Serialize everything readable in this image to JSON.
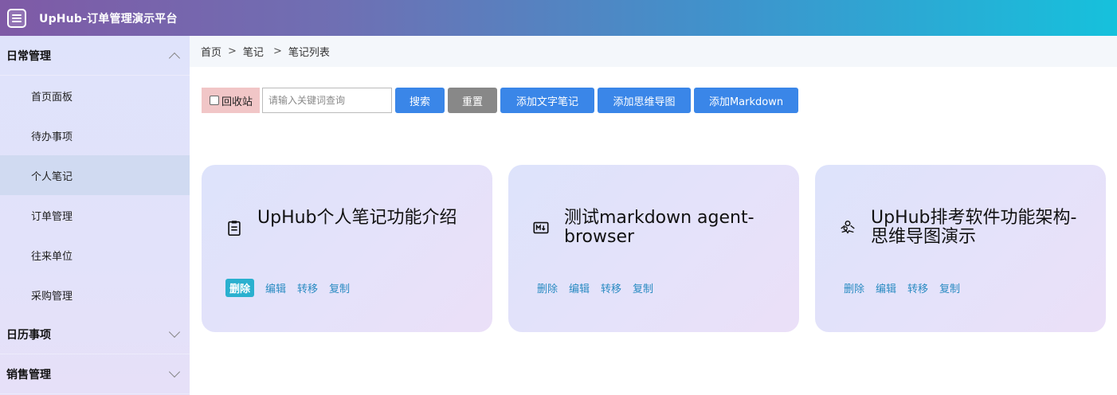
{
  "header": {
    "title": "UpHub-订单管理演示平台",
    "logo_icon": "list-doc-icon"
  },
  "sidebar": {
    "groups": [
      {
        "label": "日常管理",
        "expanded": true,
        "items": [
          {
            "label": "首页面板"
          },
          {
            "label": "待办事项"
          },
          {
            "label": "个人笔记",
            "active": true
          },
          {
            "label": "订单管理"
          },
          {
            "label": "往来单位"
          },
          {
            "label": "采购管理"
          }
        ]
      },
      {
        "label": "日历事项",
        "expanded": false
      },
      {
        "label": "销售管理",
        "expanded": false
      }
    ]
  },
  "breadcrumb": {
    "items": [
      "首页",
      "笔记",
      "笔记列表"
    ],
    "separator": ">"
  },
  "toolbar": {
    "recycle_label": "回收站",
    "recycle_checked": false,
    "search_placeholder": "请输入关键词查询",
    "search_value": "",
    "buttons": [
      "搜索",
      "重置",
      "添加文字笔记",
      "添加思维导图",
      "添加Markdown"
    ]
  },
  "notes": [
    {
      "title": "UpHub个人笔记功能介绍",
      "icon": "clipboard-note-icon",
      "actions": [
        "删除",
        "编辑",
        "转移",
        "复制"
      ]
    },
    {
      "title": "测试markdown agent-browser",
      "icon": "markdown-icon",
      "actions": [
        "删除",
        "编辑",
        "转移",
        "复制"
      ]
    },
    {
      "title": "UpHub排考软件功能架构-思维导图演示",
      "icon": "mindmap-icon",
      "actions": [
        "删除",
        "编辑",
        "转移",
        "复制"
      ]
    }
  ],
  "colors": {
    "accent": "#3a86e8",
    "reset": "#888888",
    "recycle_bg": "#f1c6c7",
    "active_chip": "#2ab0cf",
    "link": "#2a8bc2"
  }
}
